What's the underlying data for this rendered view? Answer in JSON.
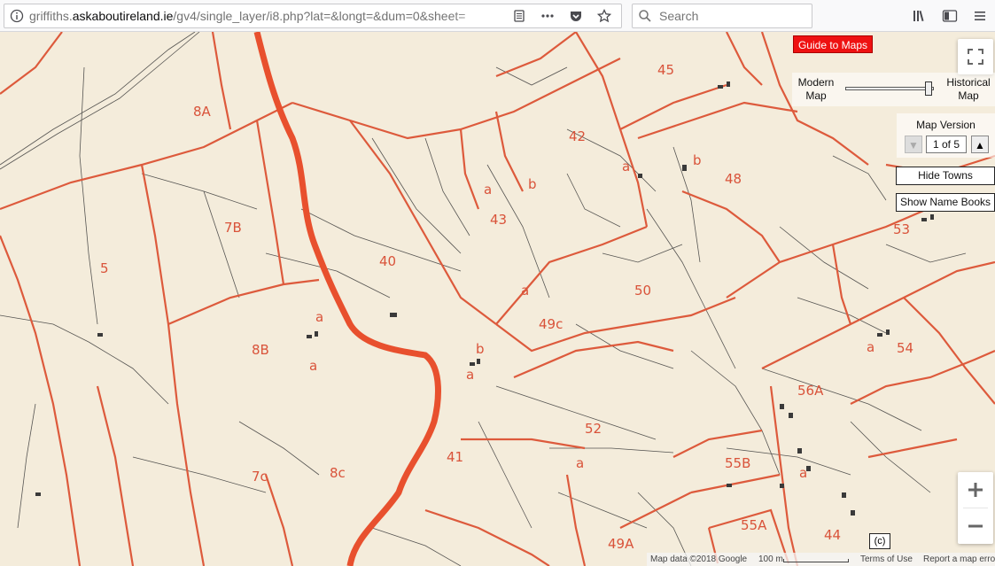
{
  "browser": {
    "url_prefix": "griffiths.",
    "url_domain": "askaboutireland.ie",
    "url_rest": "/gv4/single_layer/i8.php?lat=&longt=&dum=0&sheet=",
    "search_placeholder": "Search",
    "icons": [
      "info-icon",
      "reader-view-icon",
      "more-icon",
      "pocket-icon",
      "bookmark-star-icon",
      "library-icon",
      "sidebar-icon",
      "menu-icon"
    ]
  },
  "map": {
    "guide_label": "Guide to Maps",
    "slider": {
      "left_label_1": "Modern",
      "left_label_2": "Map",
      "right_label_1": "Historical",
      "right_label_2": "Map",
      "value": 1.0
    },
    "version": {
      "title": "Map Version",
      "value": "1 of 5",
      "down": "▼",
      "up": "▲"
    },
    "hide_towns": "Hide Towns",
    "show_name_books": "Show Name Books",
    "zoom_in": "+",
    "zoom_out": "−",
    "copyright_box": "(c)",
    "attribution": {
      "map_data": "Map data ©2018 Google",
      "scale": "100 m",
      "terms": "Terms of Use",
      "report": "Report a map error"
    },
    "plot_labels": [
      "8A",
      "45",
      "42",
      "a",
      "b",
      "b",
      "48",
      "7B",
      "43",
      "53",
      "5",
      "40",
      "a",
      "a",
      "50",
      "49c",
      "a",
      "8B",
      "a",
      "54",
      "a",
      "b",
      "56A",
      "52",
      "a",
      "55B",
      "41",
      "7c",
      "8c",
      "a",
      "55A",
      "49A",
      "44",
      "a"
    ],
    "colors": {
      "paper": "#f4ecdb",
      "boundary_red": "#dd5a3c",
      "river_red": "#e8502e",
      "ink": "#3a3a3a",
      "guide_red": "#ee1111"
    }
  }
}
